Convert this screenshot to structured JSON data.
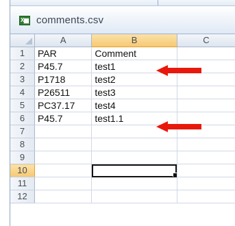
{
  "window": {
    "title": "comments.csv",
    "file_icon": "excel-file-icon"
  },
  "columns": [
    "A",
    "B",
    "C"
  ],
  "rows": [
    {
      "num": "1",
      "a": "PAR",
      "b": "Comment",
      "c": ""
    },
    {
      "num": "2",
      "a": "P45.7",
      "b": "test1",
      "c": ""
    },
    {
      "num": "3",
      "a": "P1718",
      "b": "test2",
      "c": ""
    },
    {
      "num": "4",
      "a": "P26511",
      "b": "test3",
      "c": ""
    },
    {
      "num": "5",
      "a": "PC37.17",
      "b": "test4",
      "c": ""
    },
    {
      "num": "6",
      "a": "P45.7",
      "b": "test1.1",
      "c": ""
    },
    {
      "num": "7",
      "a": "",
      "b": "",
      "c": ""
    },
    {
      "num": "8",
      "a": "",
      "b": "",
      "c": ""
    },
    {
      "num": "9",
      "a": "",
      "b": "",
      "c": ""
    },
    {
      "num": "10",
      "a": "",
      "b": "",
      "c": ""
    },
    {
      "num": "11",
      "a": "",
      "b": "",
      "c": ""
    },
    {
      "num": "12",
      "a": "",
      "b": "",
      "c": ""
    }
  ],
  "selection": {
    "active_cell": "B10",
    "active_column": "B",
    "active_row": "10"
  },
  "annotations": [
    {
      "icon": "red-arrow-icon",
      "points_to": "B2"
    },
    {
      "icon": "red-arrow-icon",
      "points_to": "B6"
    }
  ],
  "colors": {
    "arrow": "#e8190c",
    "header_active": "#f7c873",
    "gridline": "#d0d7e5",
    "header_bg": "#dde5ef"
  }
}
